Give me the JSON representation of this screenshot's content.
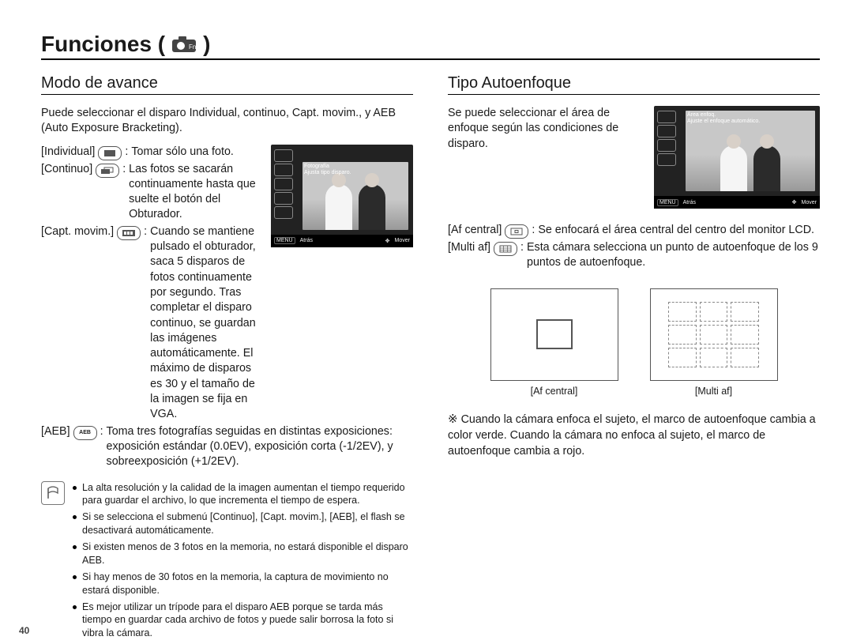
{
  "title": "Funciones (",
  "title_close": ")",
  "page_number": "40",
  "left": {
    "heading": "Modo de avance",
    "intro": "Puede seleccionar el disparo Individual, continuo, Capt. movim., y AEB (Auto Exposure Bracketing).",
    "items": {
      "individual": {
        "term": "[Individual]",
        "desc": "Tomar sólo una foto."
      },
      "continuo": {
        "term": "[Continuo]",
        "desc": "Las fotos se sacarán continuamente hasta que suelte el botón del Obturador."
      },
      "capt": {
        "term": "[Capt. movim.]",
        "desc": "Cuando se mantiene pulsado el obturador, saca 5 disparos de fotos continuamente por segundo. Tras completar el disparo continuo, se guardan las imágenes automáticamente. El máximo de disparos es 30 y el tamaño de la imagen se fija en VGA."
      },
      "aeb": {
        "term": "[AEB]",
        "desc": "Toma tres fotografías seguidas en distintas exposiciones: exposición estándar (0.0EV), exposición corta (-1/2EV), y sobreexposición (+1/2EV)."
      }
    },
    "lcd": {
      "hint1": "Fotografía",
      "hint2": "Ajusta tipo disparo.",
      "back": "Atrás",
      "move": "Mover",
      "menu": "MENU"
    },
    "notes": [
      "La alta resolución y la calidad de la imagen aumentan el tiempo requerido para guardar el archivo, lo que incrementa el tiempo de espera.",
      "Si se selecciona el submenú [Continuo], [Capt. movim.], [AEB], el flash se desactivará automáticamente.",
      "Si existen menos de 3 fotos en la memoria, no estará disponible el disparo AEB.",
      "Si hay menos de 30 fotos en la memoria, la captura de movimiento no estará disponible.",
      "Es mejor utilizar un trípode para el disparo AEB porque se tarda más tiempo en guardar cada archivo de fotos y puede salir borrosa la foto si vibra la cámara."
    ]
  },
  "right": {
    "heading": "Tipo Autoenfoque",
    "intro": "Se puede seleccionar el área de enfoque según las condiciones de disparo.",
    "lcd": {
      "hint1": "Área enfoq.",
      "hint2": "Ajuste el enfoque automático.",
      "back": "Atrás",
      "move": "Mover",
      "menu": "MENU"
    },
    "items": {
      "central": {
        "term": "[Af central]",
        "desc": "Se enfocará el área central del centro del monitor LCD."
      },
      "multi": {
        "term": "[Multi af]",
        "desc": "Esta cámara selecciona un punto de autoenfoque de los 9 puntos de autoenfoque."
      }
    },
    "dia": {
      "central": "[Af central]",
      "multi": "[Multi af]"
    },
    "starnote": "Cuando la cámara enfoca el sujeto, el marco de autoenfoque cambia a color verde. Cuando la cámara no enfoca al sujeto, el marco de autoenfoque cambia a rojo."
  }
}
